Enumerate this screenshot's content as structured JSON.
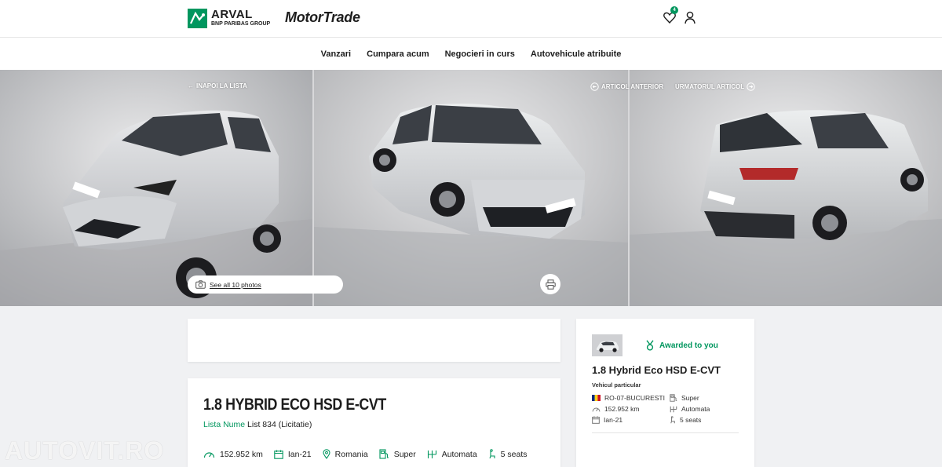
{
  "header": {
    "arval_brand": "ARVAL",
    "arval_sub": "BNP PARIBAS GROUP",
    "motortrade_brand": "MotorTrade",
    "favorites_count": "4"
  },
  "nav": {
    "items": [
      "Vanzari",
      "Cumpara acum",
      "Negocieri in curs",
      "Autovehicule atribuite"
    ]
  },
  "gallery": {
    "back_label": "INAPOI LA LISTA",
    "prev_label": "ARTICOL ANTERIOR",
    "next_label": "URMATORUL ARTICOL",
    "see_all_label": "See all 10 photos"
  },
  "vehicle": {
    "title": "1.8 HYBRID ECO HSD E-CVT",
    "list_label": "Lista Nume",
    "list_value": "List 834 (Licitatie)",
    "specs": {
      "mileage": "152.952 km",
      "date": "Ian-21",
      "country": "Romania",
      "fuel": "Super",
      "gearbox": "Automata",
      "seats": "5 seats"
    }
  },
  "side_card": {
    "award_label": "Awarded to you",
    "title": "1.8 Hybrid Eco HSD E-CVT",
    "subtitle": "Vehicul particular",
    "location": "RO-07-BUCURESTI",
    "fuel": "Super",
    "mileage": "152.952 km",
    "gearbox": "Automata",
    "date": "Ian-21",
    "seats": "5 seats"
  },
  "watermark": "AUTOVIT.RO",
  "colors": {
    "accent": "#00965e",
    "background": "#f0f1f3"
  }
}
